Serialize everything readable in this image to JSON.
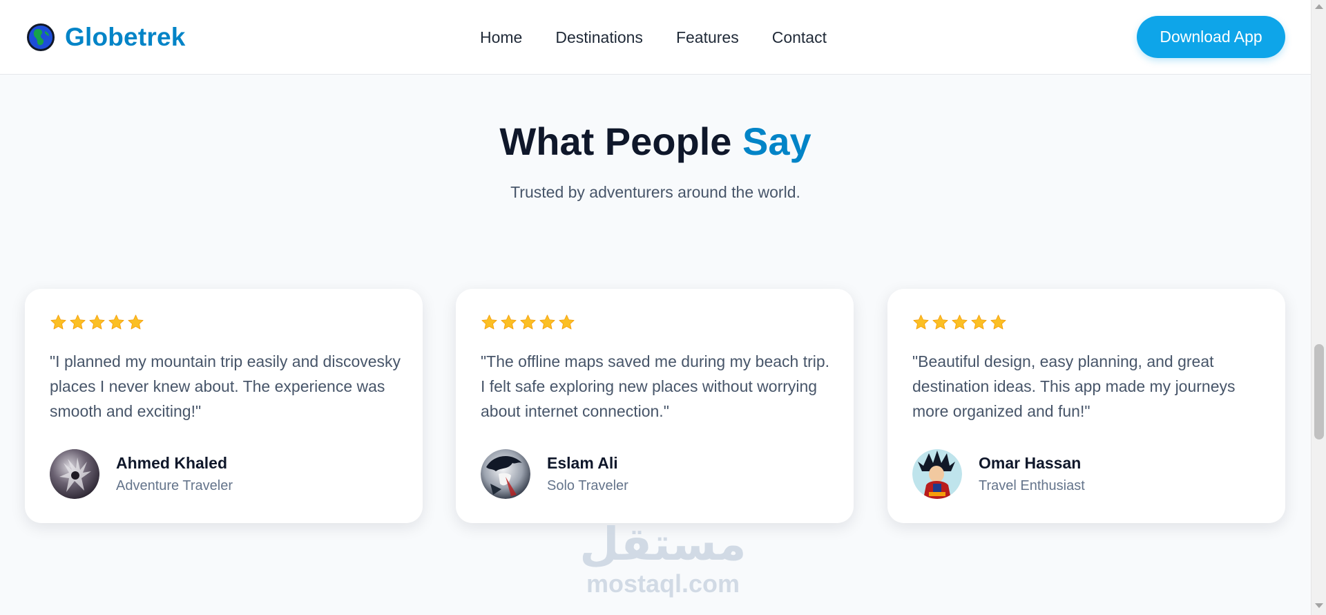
{
  "header": {
    "brand": "Globetrek",
    "nav": [
      "Home",
      "Destinations",
      "Features",
      "Contact"
    ],
    "cta_label": "Download App"
  },
  "section": {
    "title_main": "What People ",
    "title_accent": "Say",
    "subtitle": "Trusted by adventurers around the world."
  },
  "testimonials": [
    {
      "rating": 5,
      "quote": "\"I planned my mountain trip easily and discovesky places I never knew about. The experience was smooth and exciting!\"",
      "name": "Ahmed Khaled",
      "role": "Adventure Traveler"
    },
    {
      "rating": 5,
      "quote": "\"The offline maps saved me during my beach trip. I felt safe exploring new places without worrying about internet connection.\"",
      "name": "Eslam Ali",
      "role": "Solo Traveler"
    },
    {
      "rating": 5,
      "quote": "\"Beautiful design, easy planning, and great destination ideas. This app made my journeys more organized and fun!\"",
      "name": "Omar Hassan",
      "role": "Travel Enthusiast"
    }
  ],
  "watermark": {
    "arabic": "مستقل",
    "latin": "mostaql.com"
  },
  "colors": {
    "accent": "#0284c7",
    "button": "#0ea5e9",
    "star": "#fbbf24"
  },
  "icons": {
    "logo": "globe-icon",
    "star": "star-icon"
  }
}
